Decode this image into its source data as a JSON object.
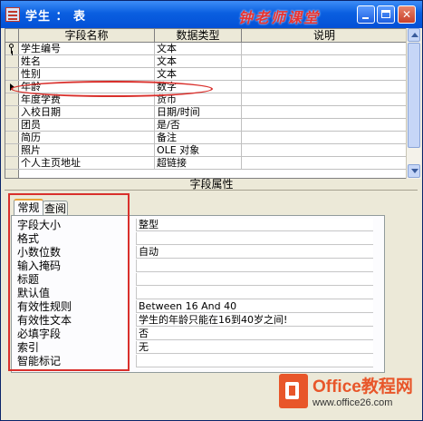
{
  "window": {
    "title": "学生 ： 表",
    "brand_text": "钟老师课堂",
    "controls": [
      "minimize",
      "maximize",
      "close"
    ],
    "close_symbol": "✕"
  },
  "grid": {
    "headers": [
      "字段名称",
      "数据类型",
      "说明"
    ],
    "rows": [
      {
        "field": "学生编号",
        "type": "文本",
        "desc": "",
        "marker": "key-icon"
      },
      {
        "field": "姓名",
        "type": "文本",
        "desc": "",
        "marker": ""
      },
      {
        "field": "性别",
        "type": "文本",
        "desc": "",
        "marker": ""
      },
      {
        "field": "年龄",
        "type": "数字",
        "desc": "",
        "marker": "current-row-arrow-icon"
      },
      {
        "field": "年度学费",
        "type": "货币",
        "desc": "",
        "marker": ""
      },
      {
        "field": "入校日期",
        "type": "日期/时间",
        "desc": "",
        "marker": ""
      },
      {
        "field": "团员",
        "type": "是/否",
        "desc": "",
        "marker": ""
      },
      {
        "field": "简历",
        "type": "备注",
        "desc": "",
        "marker": ""
      },
      {
        "field": "照片",
        "type": "OLE 对象",
        "desc": "",
        "marker": ""
      },
      {
        "field": "个人主页地址",
        "type": "超链接",
        "desc": "",
        "marker": ""
      }
    ]
  },
  "properties": {
    "section_label": "字段属性",
    "tabs": [
      {
        "label": "常规",
        "active": true
      },
      {
        "label": "查阅",
        "active": false
      }
    ],
    "items": [
      {
        "label": "字段大小",
        "value": "整型"
      },
      {
        "label": "格式",
        "value": ""
      },
      {
        "label": "小数位数",
        "value": "自动"
      },
      {
        "label": "输入掩码",
        "value": ""
      },
      {
        "label": "标题",
        "value": ""
      },
      {
        "label": "默认值",
        "value": ""
      },
      {
        "label": "有效性规则",
        "value": "Between 16 And 40"
      },
      {
        "label": "有效性文本",
        "value": "学生的年龄只能在16到40岁之间!"
      },
      {
        "label": "必填字段",
        "value": "否"
      },
      {
        "label": "索引",
        "value": "无"
      },
      {
        "label": "智能标记",
        "value": ""
      }
    ]
  },
  "watermark": {
    "text": "Office教程网",
    "url": "www.office26.com"
  },
  "colors": {
    "title_bar": "#0a5fe0",
    "annotation": "#d9302c",
    "logo": "#e8562a"
  }
}
